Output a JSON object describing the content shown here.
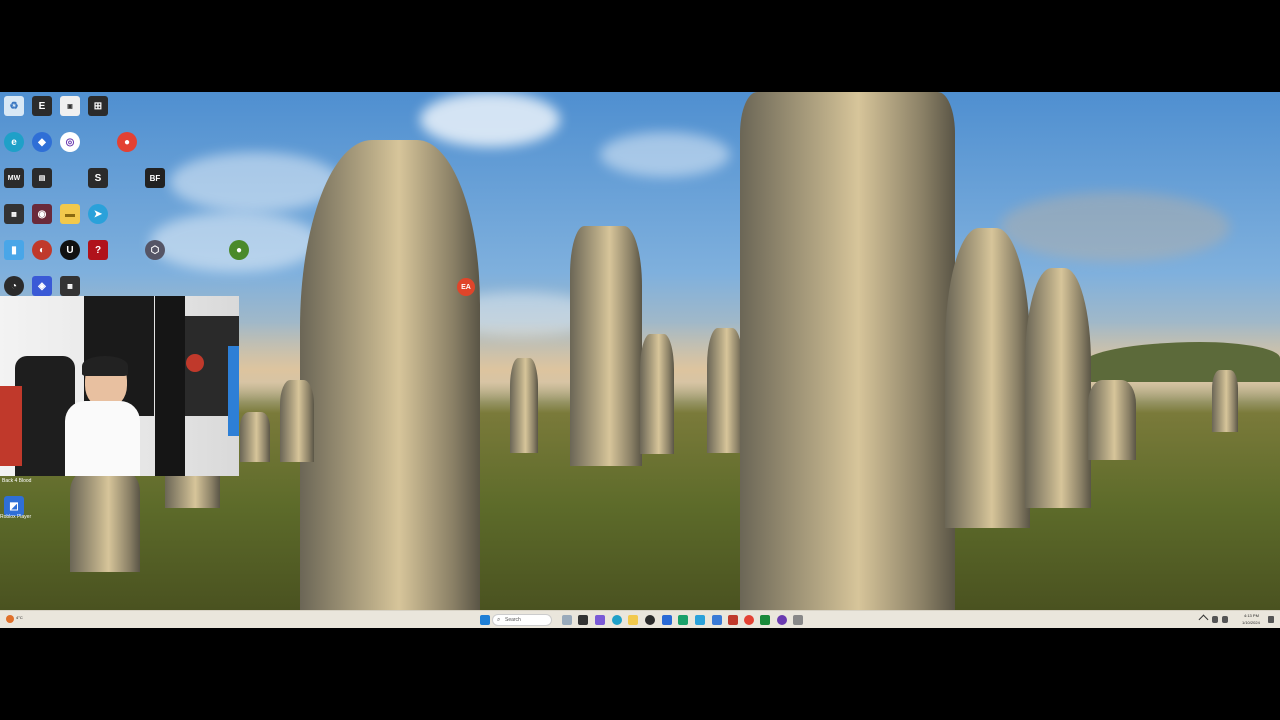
{
  "taskbar": {
    "search_placeholder": "Search",
    "weather_text": "4°C",
    "clock_time": "4:13 PM",
    "clock_date": "1/10/2024"
  },
  "desktop_labels": {
    "label_back4blood": "Back 4 Blood",
    "label_roblox_player": "Roblox Player"
  },
  "icon_colors": {
    "recycle": "#d8e8f5",
    "epic": "#2b2b2b",
    "chrome": "#e34133",
    "edge": "#1fa0c8",
    "folder": "#f2c94c",
    "telegram": "#2aa1da",
    "unreal": "#111111",
    "obs": "#2b2b2b",
    "roblox": "#2f6fd6",
    "ea": "#e0452a"
  }
}
